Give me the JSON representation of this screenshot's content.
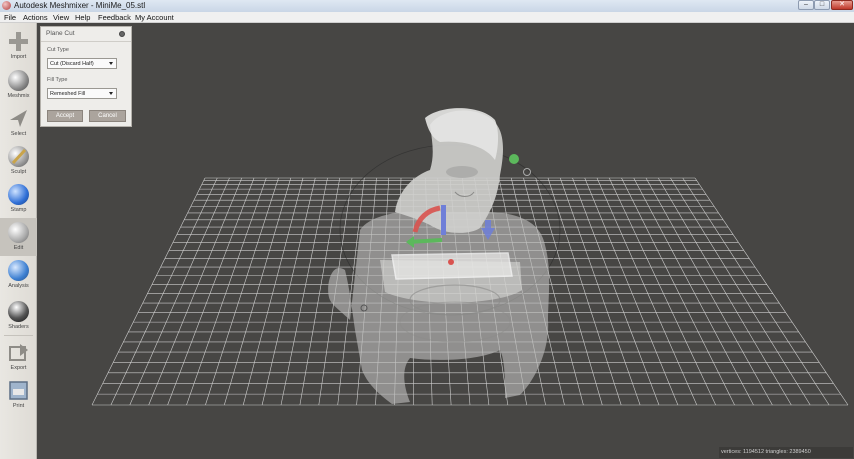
{
  "window": {
    "title": "Autodesk Meshmixer - MiniMe_05.stl",
    "minimize_glyph": "–",
    "maximize_glyph": "□",
    "close_glyph": "✕"
  },
  "menu": {
    "items": [
      "File",
      "Actions",
      "View",
      "Help",
      "Feedback",
      "My Account"
    ]
  },
  "toolbar": {
    "items": [
      {
        "label": "Import",
        "icon": "plus-icon"
      },
      {
        "label": "Meshmix",
        "icon": "meshmix-icon"
      },
      {
        "label": "Select",
        "icon": "select-arrow-icon"
      },
      {
        "label": "Sculpt",
        "icon": "sculpt-brush-icon"
      },
      {
        "label": "Stamp",
        "icon": "stamp-icon"
      },
      {
        "label": "Edit",
        "icon": "edit-icon"
      },
      {
        "label": "Analysis",
        "icon": "analysis-icon"
      },
      {
        "label": "Shaders",
        "icon": "shaders-icon"
      },
      {
        "label": "Export",
        "icon": "export-icon"
      },
      {
        "label": "Print",
        "icon": "print-icon"
      }
    ],
    "active": "Edit"
  },
  "panel": {
    "title": "Plane Cut",
    "cut_type_label": "Cut Type",
    "cut_type_value": "Cut (Discard Half)",
    "fill_type_label": "Fill Type",
    "fill_type_value": "Remeshed Fill",
    "accept_label": "Accept",
    "cancel_label": "Cancel"
  },
  "status": {
    "text": "vertices: 1194512 triangles: 2389450"
  },
  "colors": {
    "viewport_bg": "#474644",
    "grid": "#e6e6e6",
    "mesh": "#d4d4d2",
    "gizmo_red": "#d9534f",
    "gizmo_green": "#5cb85c",
    "gizmo_blue": "#6f7fd8"
  }
}
